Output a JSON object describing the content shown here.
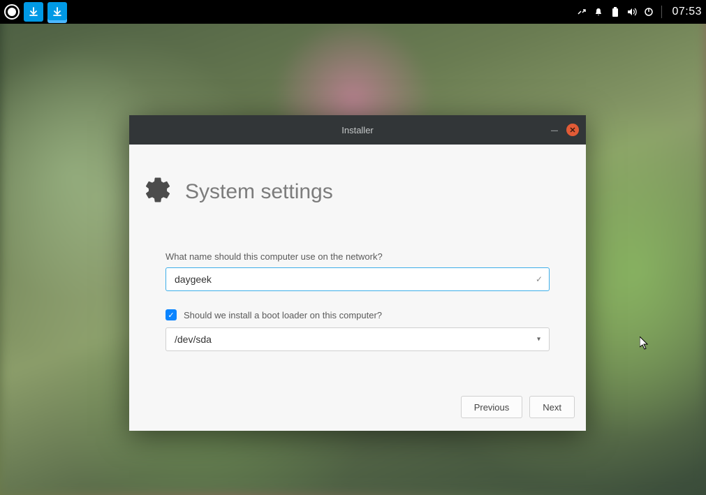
{
  "panel": {
    "clock": "07:53"
  },
  "window": {
    "title": "Installer",
    "heading": "System settings",
    "hostname": {
      "label": "What name should this computer use on the network?",
      "value": "daygeek"
    },
    "bootloader": {
      "label": "Should we install a boot loader on this computer?",
      "checked": true,
      "device": "/dev/sda"
    },
    "buttons": {
      "previous": "Previous",
      "next": "Next"
    }
  }
}
